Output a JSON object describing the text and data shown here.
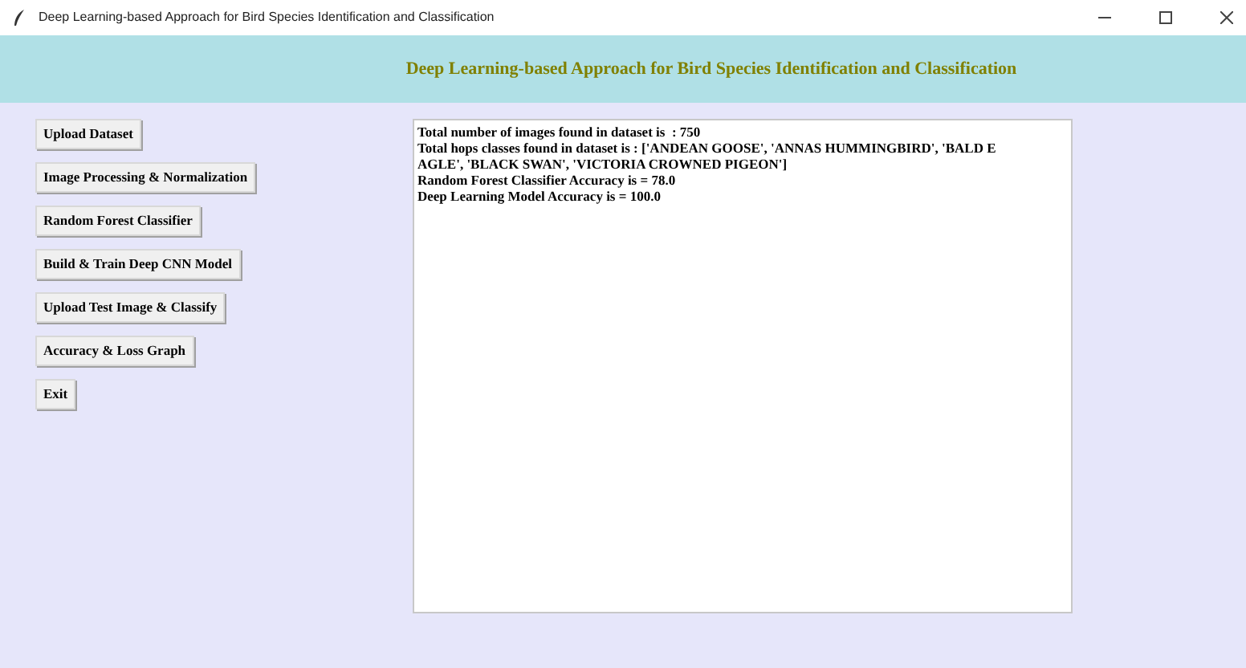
{
  "window": {
    "title": "Deep Learning-based Approach for Bird Species Identification and Classification"
  },
  "header": {
    "title": "Deep Learning-based Approach for Bird Species Identification and Classification"
  },
  "buttons": [
    "Upload Dataset",
    "Image Processing & Normalization",
    "Random Forest Classifier",
    "Build & Train Deep CNN Model",
    "Upload Test Image & Classify",
    "Accuracy & Loss Graph",
    "Exit"
  ],
  "output": {
    "lines": [
      "Total number of images found in dataset is  : 750",
      "Total hops classes found in dataset is : ['ANDEAN GOOSE', 'ANNAS HUMMINGBIRD', 'BALD E",
      "AGLE', 'BLACK SWAN', 'VICTORIA CROWNED PIGEON']",
      "Random Forest Classifier Accuracy is = 78.0",
      "Deep Learning Model Accuracy is = 100.0"
    ]
  }
}
